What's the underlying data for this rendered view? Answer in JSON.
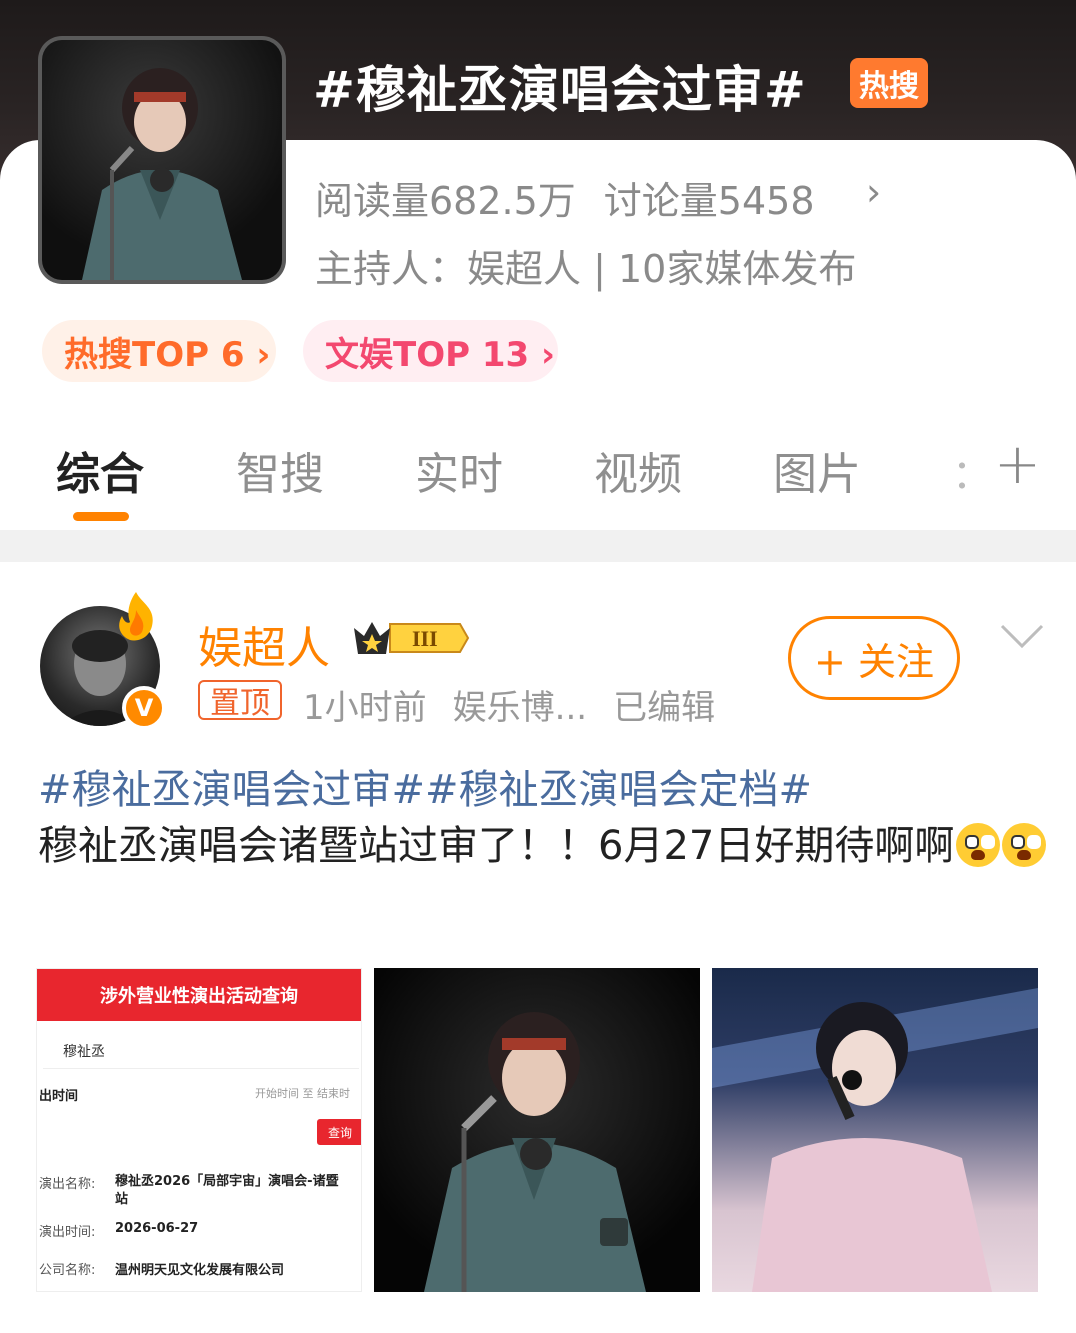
{
  "topic": {
    "title": "#穆祉丞演唱会过审#",
    "hot_badge": "热搜",
    "reads": "阅读量682.5万",
    "discussions": "讨论量5458",
    "host": "主持人：娱超人 | 10家媒体发布",
    "rank_hot": "热搜TOP 6 ›",
    "rank_ent": "文娱TOP 13 ›"
  },
  "tabs": [
    {
      "label": "综合",
      "active": true
    },
    {
      "label": "智搜",
      "active": false
    },
    {
      "label": "实时",
      "active": false
    },
    {
      "label": "视频",
      "active": false
    },
    {
      "label": "图片",
      "active": false
    }
  ],
  "tab_more": "：",
  "tab_plus": "+",
  "post": {
    "username": "娱超人",
    "level": "III",
    "pin_label": "置顶",
    "time": "1小时前",
    "source": "娱乐博...",
    "edited": "已编辑",
    "follow_label": "+ 关注",
    "hashtag1": "#穆祉丞演唱会过审#",
    "hashtag2": "#穆祉丞演唱会定档#",
    "body": "穆祉丞演唱会诸暨站过审了！！6月27日好期待啊啊",
    "emoji": "shocked-face-emoji"
  },
  "doc_image": {
    "header": "涉外营业性演出活动查询",
    "search_value": "穆祉丞",
    "time_label": "出时间",
    "time_range": "开始时间 至 结束时",
    "query_button": "查询",
    "name_label": "演出名称:",
    "name_value": "穆祉丞2026「局部宇宙」演唱会-诸暨站",
    "date_label": "演出时间:",
    "date_value": "2026-06-27",
    "company_label": "公司名称:",
    "company_value": "温州明天见文化发展有限公司"
  },
  "colors": {
    "accent_orange": "#ff8200",
    "hashtag_blue": "#4a6c9e",
    "hot_badge": "#ff7a2f"
  }
}
